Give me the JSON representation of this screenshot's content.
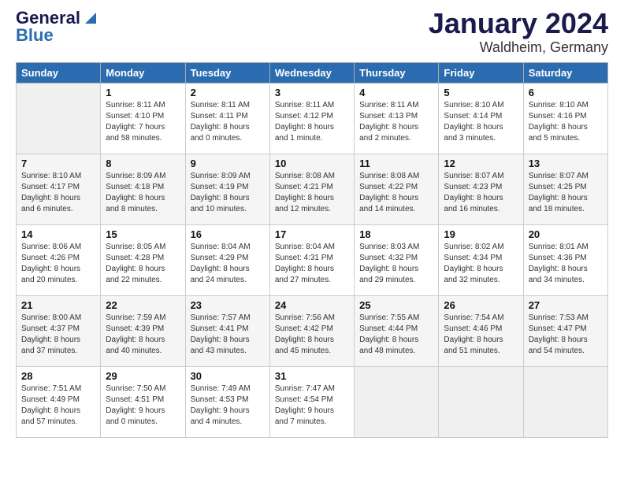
{
  "logo": {
    "line1": "General",
    "line2": "Blue"
  },
  "title": "January 2024",
  "subtitle": "Waldheim, Germany",
  "weekdays": [
    "Sunday",
    "Monday",
    "Tuesday",
    "Wednesday",
    "Thursday",
    "Friday",
    "Saturday"
  ],
  "weeks": [
    [
      {
        "day": "",
        "info": ""
      },
      {
        "day": "1",
        "info": "Sunrise: 8:11 AM\nSunset: 4:10 PM\nDaylight: 7 hours\nand 58 minutes."
      },
      {
        "day": "2",
        "info": "Sunrise: 8:11 AM\nSunset: 4:11 PM\nDaylight: 8 hours\nand 0 minutes."
      },
      {
        "day": "3",
        "info": "Sunrise: 8:11 AM\nSunset: 4:12 PM\nDaylight: 8 hours\nand 1 minute."
      },
      {
        "day": "4",
        "info": "Sunrise: 8:11 AM\nSunset: 4:13 PM\nDaylight: 8 hours\nand 2 minutes."
      },
      {
        "day": "5",
        "info": "Sunrise: 8:10 AM\nSunset: 4:14 PM\nDaylight: 8 hours\nand 3 minutes."
      },
      {
        "day": "6",
        "info": "Sunrise: 8:10 AM\nSunset: 4:16 PM\nDaylight: 8 hours\nand 5 minutes."
      }
    ],
    [
      {
        "day": "7",
        "info": "Sunrise: 8:10 AM\nSunset: 4:17 PM\nDaylight: 8 hours\nand 6 minutes."
      },
      {
        "day": "8",
        "info": "Sunrise: 8:09 AM\nSunset: 4:18 PM\nDaylight: 8 hours\nand 8 minutes."
      },
      {
        "day": "9",
        "info": "Sunrise: 8:09 AM\nSunset: 4:19 PM\nDaylight: 8 hours\nand 10 minutes."
      },
      {
        "day": "10",
        "info": "Sunrise: 8:08 AM\nSunset: 4:21 PM\nDaylight: 8 hours\nand 12 minutes."
      },
      {
        "day": "11",
        "info": "Sunrise: 8:08 AM\nSunset: 4:22 PM\nDaylight: 8 hours\nand 14 minutes."
      },
      {
        "day": "12",
        "info": "Sunrise: 8:07 AM\nSunset: 4:23 PM\nDaylight: 8 hours\nand 16 minutes."
      },
      {
        "day": "13",
        "info": "Sunrise: 8:07 AM\nSunset: 4:25 PM\nDaylight: 8 hours\nand 18 minutes."
      }
    ],
    [
      {
        "day": "14",
        "info": "Sunrise: 8:06 AM\nSunset: 4:26 PM\nDaylight: 8 hours\nand 20 minutes."
      },
      {
        "day": "15",
        "info": "Sunrise: 8:05 AM\nSunset: 4:28 PM\nDaylight: 8 hours\nand 22 minutes."
      },
      {
        "day": "16",
        "info": "Sunrise: 8:04 AM\nSunset: 4:29 PM\nDaylight: 8 hours\nand 24 minutes."
      },
      {
        "day": "17",
        "info": "Sunrise: 8:04 AM\nSunset: 4:31 PM\nDaylight: 8 hours\nand 27 minutes."
      },
      {
        "day": "18",
        "info": "Sunrise: 8:03 AM\nSunset: 4:32 PM\nDaylight: 8 hours\nand 29 minutes."
      },
      {
        "day": "19",
        "info": "Sunrise: 8:02 AM\nSunset: 4:34 PM\nDaylight: 8 hours\nand 32 minutes."
      },
      {
        "day": "20",
        "info": "Sunrise: 8:01 AM\nSunset: 4:36 PM\nDaylight: 8 hours\nand 34 minutes."
      }
    ],
    [
      {
        "day": "21",
        "info": "Sunrise: 8:00 AM\nSunset: 4:37 PM\nDaylight: 8 hours\nand 37 minutes."
      },
      {
        "day": "22",
        "info": "Sunrise: 7:59 AM\nSunset: 4:39 PM\nDaylight: 8 hours\nand 40 minutes."
      },
      {
        "day": "23",
        "info": "Sunrise: 7:57 AM\nSunset: 4:41 PM\nDaylight: 8 hours\nand 43 minutes."
      },
      {
        "day": "24",
        "info": "Sunrise: 7:56 AM\nSunset: 4:42 PM\nDaylight: 8 hours\nand 45 minutes."
      },
      {
        "day": "25",
        "info": "Sunrise: 7:55 AM\nSunset: 4:44 PM\nDaylight: 8 hours\nand 48 minutes."
      },
      {
        "day": "26",
        "info": "Sunrise: 7:54 AM\nSunset: 4:46 PM\nDaylight: 8 hours\nand 51 minutes."
      },
      {
        "day": "27",
        "info": "Sunrise: 7:53 AM\nSunset: 4:47 PM\nDaylight: 8 hours\nand 54 minutes."
      }
    ],
    [
      {
        "day": "28",
        "info": "Sunrise: 7:51 AM\nSunset: 4:49 PM\nDaylight: 8 hours\nand 57 minutes."
      },
      {
        "day": "29",
        "info": "Sunrise: 7:50 AM\nSunset: 4:51 PM\nDaylight: 9 hours\nand 0 minutes."
      },
      {
        "day": "30",
        "info": "Sunrise: 7:49 AM\nSunset: 4:53 PM\nDaylight: 9 hours\nand 4 minutes."
      },
      {
        "day": "31",
        "info": "Sunrise: 7:47 AM\nSunset: 4:54 PM\nDaylight: 9 hours\nand 7 minutes."
      },
      {
        "day": "",
        "info": ""
      },
      {
        "day": "",
        "info": ""
      },
      {
        "day": "",
        "info": ""
      }
    ]
  ]
}
